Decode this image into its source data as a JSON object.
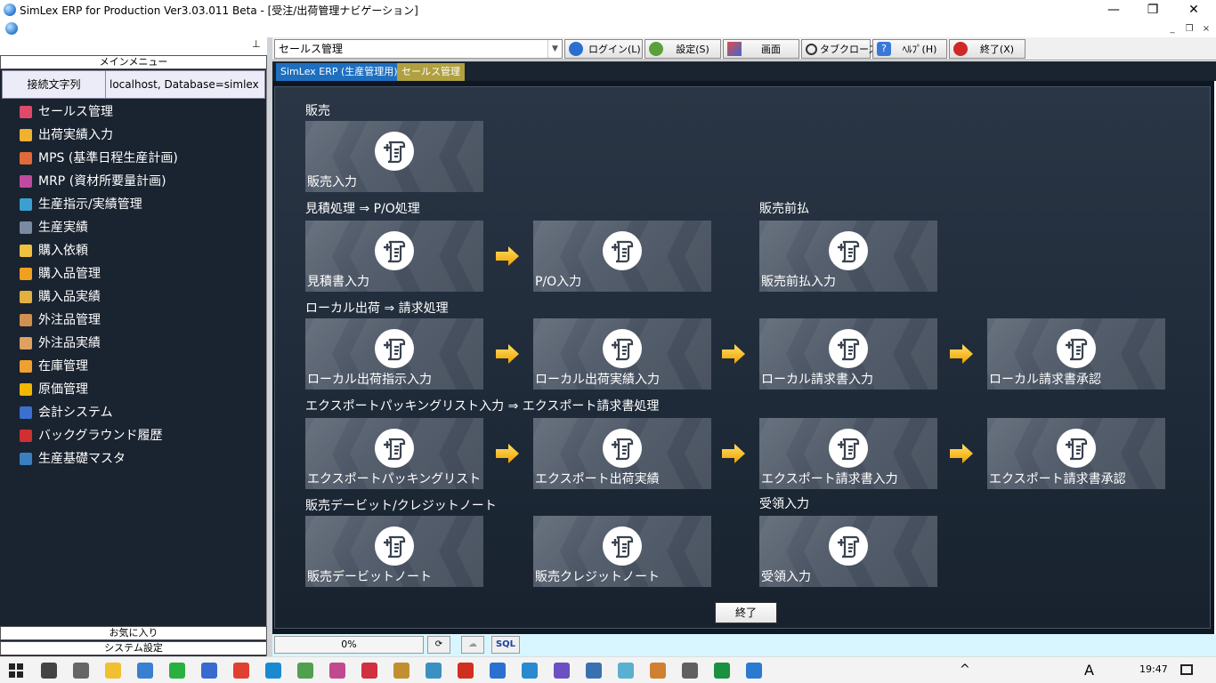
{
  "window": {
    "title": "SimLex ERP for Production Ver3.03.011 Beta - [受注/出荷管理ナビゲーション]",
    "min_glyph": "—",
    "max_glyph": "❐",
    "close_glyph": "✕"
  },
  "mdi": {
    "min_glyph": "_",
    "restore_glyph": "❐",
    "close_glyph": "×"
  },
  "left_panel": {
    "pin_glyph": "⊥",
    "menu_title": "メインメニュー",
    "connection_label": "接続文字列",
    "connection_value": "localhost, Database=simlex",
    "items": [
      {
        "label": "セールス管理",
        "color": "#e04a6a"
      },
      {
        "label": "出荷実績入力",
        "color": "#f0b030"
      },
      {
        "label": "MPS (基準日程生産計画)",
        "color": "#e06a3a"
      },
      {
        "label": "MRP (資材所要量計画)",
        "color": "#c04aa0"
      },
      {
        "label": "生産指示/実績管理",
        "color": "#3aa0d0"
      },
      {
        "label": "生産実績",
        "color": "#7a8aa0"
      },
      {
        "label": "購入依頼",
        "color": "#f0c040"
      },
      {
        "label": "購入品管理",
        "color": "#f0a020"
      },
      {
        "label": "購入品実績",
        "color": "#e0b040"
      },
      {
        "label": "外注品管理",
        "color": "#d09050"
      },
      {
        "label": "外注品実績",
        "color": "#e0a060"
      },
      {
        "label": "在庫管理",
        "color": "#f0a030"
      },
      {
        "label": "原価管理",
        "color": "#f0b800"
      },
      {
        "label": "会計システム",
        "color": "#3a70d0"
      },
      {
        "label": "バックグラウンド履歴",
        "color": "#d03030"
      },
      {
        "label": "生産基礎マスタ",
        "color": "#3a80c0"
      }
    ],
    "favorites": "お気に入り",
    "system_settings": "システム設定"
  },
  "toolbar": {
    "module_value": "セールス管理",
    "login": "ログイン(L)",
    "settings": "設定(S)",
    "screen": "画面",
    "tab_close": "タブクローズ",
    "help": "ﾍﾙﾌﾟ(H)",
    "exit": "終了(X)"
  },
  "tabs": [
    {
      "label": "SimLex ERP (生産管理用)",
      "bg": "#1f6fbf"
    },
    {
      "label": "セールス管理",
      "bg": "#b0a040"
    }
  ],
  "sections": {
    "sales": "販売",
    "estimate": "見積処理 ⇒ P/O処理",
    "prepay": "販売前払",
    "local": "ローカル出荷 ⇒ 請求処理",
    "export": "エクスポートパッキングリスト入力 ⇒ エクスポート請求書処理",
    "debit_credit": "販売デービット/クレジットノート",
    "receipt": "受領入力"
  },
  "tiles": {
    "sales_entry": "販売入力",
    "estimate_entry": "見積書入力",
    "po_entry": "P/O入力",
    "prepay_entry": "販売前払入力",
    "local_ship_order": "ローカル出荷指示入力",
    "local_ship_actual": "ローカル出荷実績入力",
    "local_invoice": "ローカル請求書入力",
    "local_invoice_approve": "ローカル請求書承認",
    "export_packing": "エクスポートパッキングリスト",
    "export_ship_actual": "エクスポート出荷実績",
    "export_invoice": "エクスポート請求書入力",
    "export_invoice_approve": "エクスポート請求書承認",
    "debit_note": "販売デービットノート",
    "credit_note": "販売クレジットノート",
    "receipt_entry": "受領入力"
  },
  "end_button": "終了",
  "status": {
    "progress": "0%",
    "sql": "SQL"
  },
  "taskbar": {
    "time": "19:47",
    "ime": "A"
  }
}
